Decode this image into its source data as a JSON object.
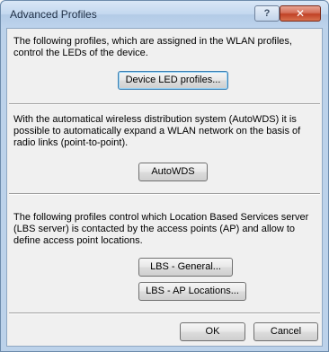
{
  "dialog": {
    "title": "Advanced Profiles",
    "help_label": "?",
    "close_label": "✕"
  },
  "sections": {
    "led": {
      "text": "The following profiles, which are assigned in the WLAN profiles, control the LEDs of the device.",
      "button": "Device LED profiles..."
    },
    "autowds": {
      "text": "With the automatical wireless distribution system (AutoWDS) it is possible to automatically expand a WLAN network on the basis of radio links (point-to-point).",
      "button": "AutoWDS"
    },
    "lbs": {
      "text": "The following profiles control which Location Based Services server (LBS server) is contacted by the access points (AP) and allow to define access point locations.",
      "button_general": "LBS - General...",
      "button_locations": "LBS - AP Locations..."
    }
  },
  "footer": {
    "ok_label": "OK",
    "cancel_label": "Cancel"
  }
}
